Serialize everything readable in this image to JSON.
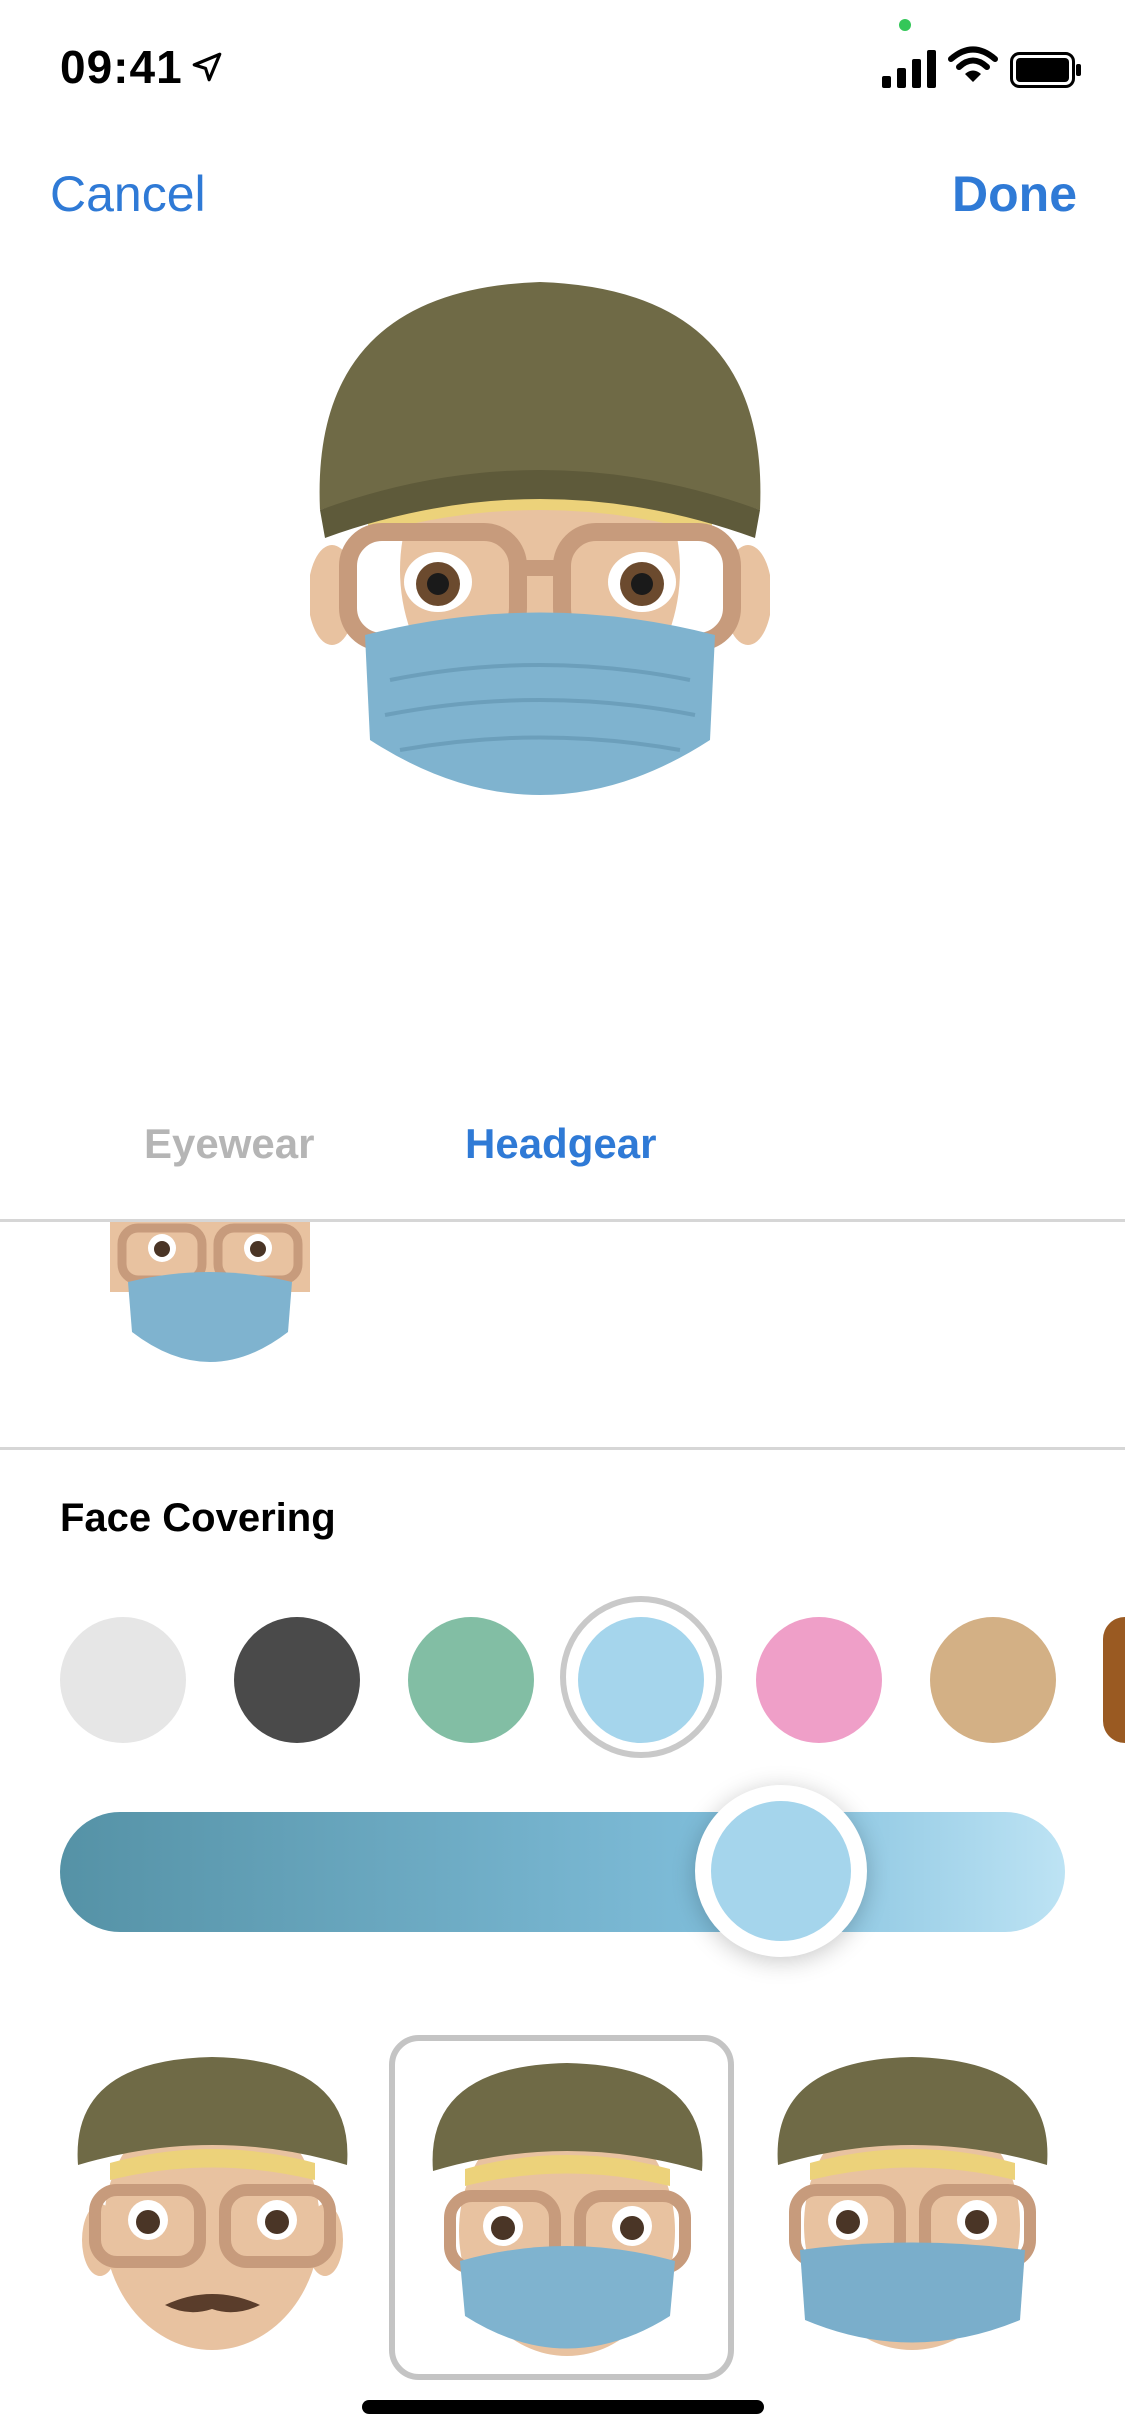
{
  "status_bar": {
    "time": "09:41"
  },
  "nav": {
    "cancel_label": "Cancel",
    "done_label": "Done"
  },
  "tabs": [
    {
      "label": "Eyewear",
      "selected": false
    },
    {
      "label": "Headgear",
      "selected": true
    }
  ],
  "section": {
    "title": "Face Covering"
  },
  "colors": {
    "accent": "#2f7ad6",
    "mask": "#7fb3cf",
    "hat": "#6f6a46",
    "skin": "#e8c2a0",
    "frames": "#c79b7c",
    "privacy_dot": "#34c759"
  },
  "swatches": [
    {
      "name": "white",
      "color": "#e6e6e6"
    },
    {
      "name": "dark-gray",
      "color": "#4a4a4a"
    },
    {
      "name": "green",
      "color": "#82bea4"
    },
    {
      "name": "light-blue",
      "color": "#a5d5ec",
      "selected": true
    },
    {
      "name": "pink",
      "color": "#ef9fc8"
    },
    {
      "name": "tan",
      "color": "#d3b085"
    },
    {
      "name": "brown",
      "color": "#9a5a22"
    }
  ],
  "shade_slider": {
    "value_fraction": 0.68
  },
  "options": [
    {
      "name": "mustache",
      "selected": false
    },
    {
      "name": "face-mask",
      "selected": true
    },
    {
      "name": "face-mask-no-frame",
      "selected": false
    }
  ]
}
